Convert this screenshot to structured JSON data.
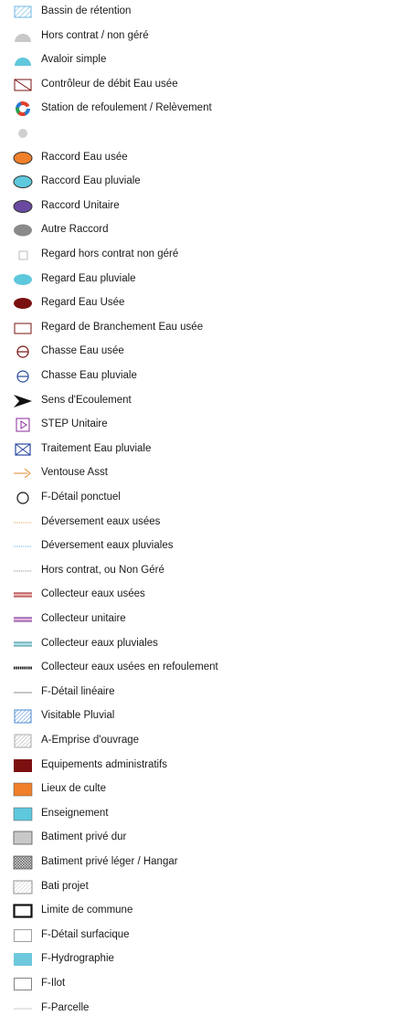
{
  "legend": {
    "items": [
      {
        "label": "Bassin de rétention",
        "icon": "hatched-square-icon"
      },
      {
        "label": "Hors contrat / non géré",
        "icon": "grey-half-disc-icon"
      },
      {
        "label": "Avaloir simple",
        "icon": "cyan-half-disc-icon"
      },
      {
        "label": "Contrôleur de débit Eau usée",
        "icon": "flow-controller-icon"
      },
      {
        "label": "Station de refoulement / Relèvement",
        "icon": "pumping-station-icon"
      },
      {
        "label": "",
        "icon": "grey-dot-icon"
      },
      {
        "label": "Raccord Eau usée",
        "icon": "orange-ellipse-icon"
      },
      {
        "label": "Raccord Eau pluviale",
        "icon": "cyan-ellipse-icon"
      },
      {
        "label": "Raccord Unitaire",
        "icon": "purple-ellipse-icon"
      },
      {
        "label": "Autre Raccord",
        "icon": "grey-ellipse-icon"
      },
      {
        "label": "Regard hors contrat non géré",
        "icon": "small-square-icon"
      },
      {
        "label": "Regard Eau pluviale",
        "icon": "cyan-oval-icon"
      },
      {
        "label": "Regard Eau Usée",
        "icon": "darkred-oval-icon"
      },
      {
        "label": "Regard de Branchement Eau usée",
        "icon": "darkred-rectangle-icon"
      },
      {
        "label": "Chasse Eau usée",
        "icon": "crossed-circle-red-icon"
      },
      {
        "label": "Chasse Eau pluviale",
        "icon": "crossed-circle-blue-icon"
      },
      {
        "label": "Sens d'Ecoulement",
        "icon": "flow-arrow-icon"
      },
      {
        "label": "STEP Unitaire",
        "icon": "step-icon"
      },
      {
        "label": "Traitement  Eau pluviale",
        "icon": "envelope-icon"
      },
      {
        "label": "Ventouse Asst",
        "icon": "vent-arrow-icon"
      },
      {
        "label": "F-Détail ponctuel",
        "icon": "circle-outline-icon"
      },
      {
        "label": "Déversement eaux usées",
        "icon": "dotted-orange-line-icon"
      },
      {
        "label": "Déversement eaux pluviales",
        "icon": "dotted-blue-line-icon"
      },
      {
        "label": "Hors contrat, ou Non Géré",
        "icon": "dotted-grey-line-icon"
      },
      {
        "label": "Collecteur eaux usées",
        "icon": "red-double-line-icon"
      },
      {
        "label": "Collecteur unitaire",
        "icon": "purple-double-line-icon"
      },
      {
        "label": "Collecteur eaux pluviales",
        "icon": "teal-double-line-icon"
      },
      {
        "label": "Collecteur eaux usées en refoulement",
        "icon": "thick-dashed-line-icon"
      },
      {
        "label": "F-Détail linéaire",
        "icon": "thin-line-icon"
      },
      {
        "label": "Visitable Pluvial",
        "icon": "blue-hatched-square-icon"
      },
      {
        "label": "A-Emprise d'ouvrage",
        "icon": "grey-hatched-square-icon"
      },
      {
        "label": "Equipements administratifs",
        "icon": "darkred-square-icon"
      },
      {
        "label": "Lieux de culte",
        "icon": "orange-square-icon"
      },
      {
        "label": "Enseignement",
        "icon": "cyan-square-icon"
      },
      {
        "label": "Batiment privé dur",
        "icon": "grey-square-icon"
      },
      {
        "label": "Batiment privé léger / Hangar",
        "icon": "crosshatch-square-icon"
      },
      {
        "label": "Bati projet",
        "icon": "light-hatched-square-icon"
      },
      {
        "label": "Limite de commune",
        "icon": "bold-outline-square-icon"
      },
      {
        "label": "F-Détail surfacique",
        "icon": "outline-square-icon"
      },
      {
        "label": "F-Hydrographie",
        "icon": "light-blue-square-icon"
      },
      {
        "label": "F-Ilot",
        "icon": "outline-square-2-icon"
      },
      {
        "label": "F-Parcelle",
        "icon": "faint-line-icon"
      }
    ]
  },
  "colors": {
    "orange": "#f07f2a",
    "cyan": "#5ec8dc",
    "purple": "#6a4aa0",
    "grey": "#8a8a8a",
    "darkred": "#7a1010",
    "teal": "#3a8a98"
  }
}
